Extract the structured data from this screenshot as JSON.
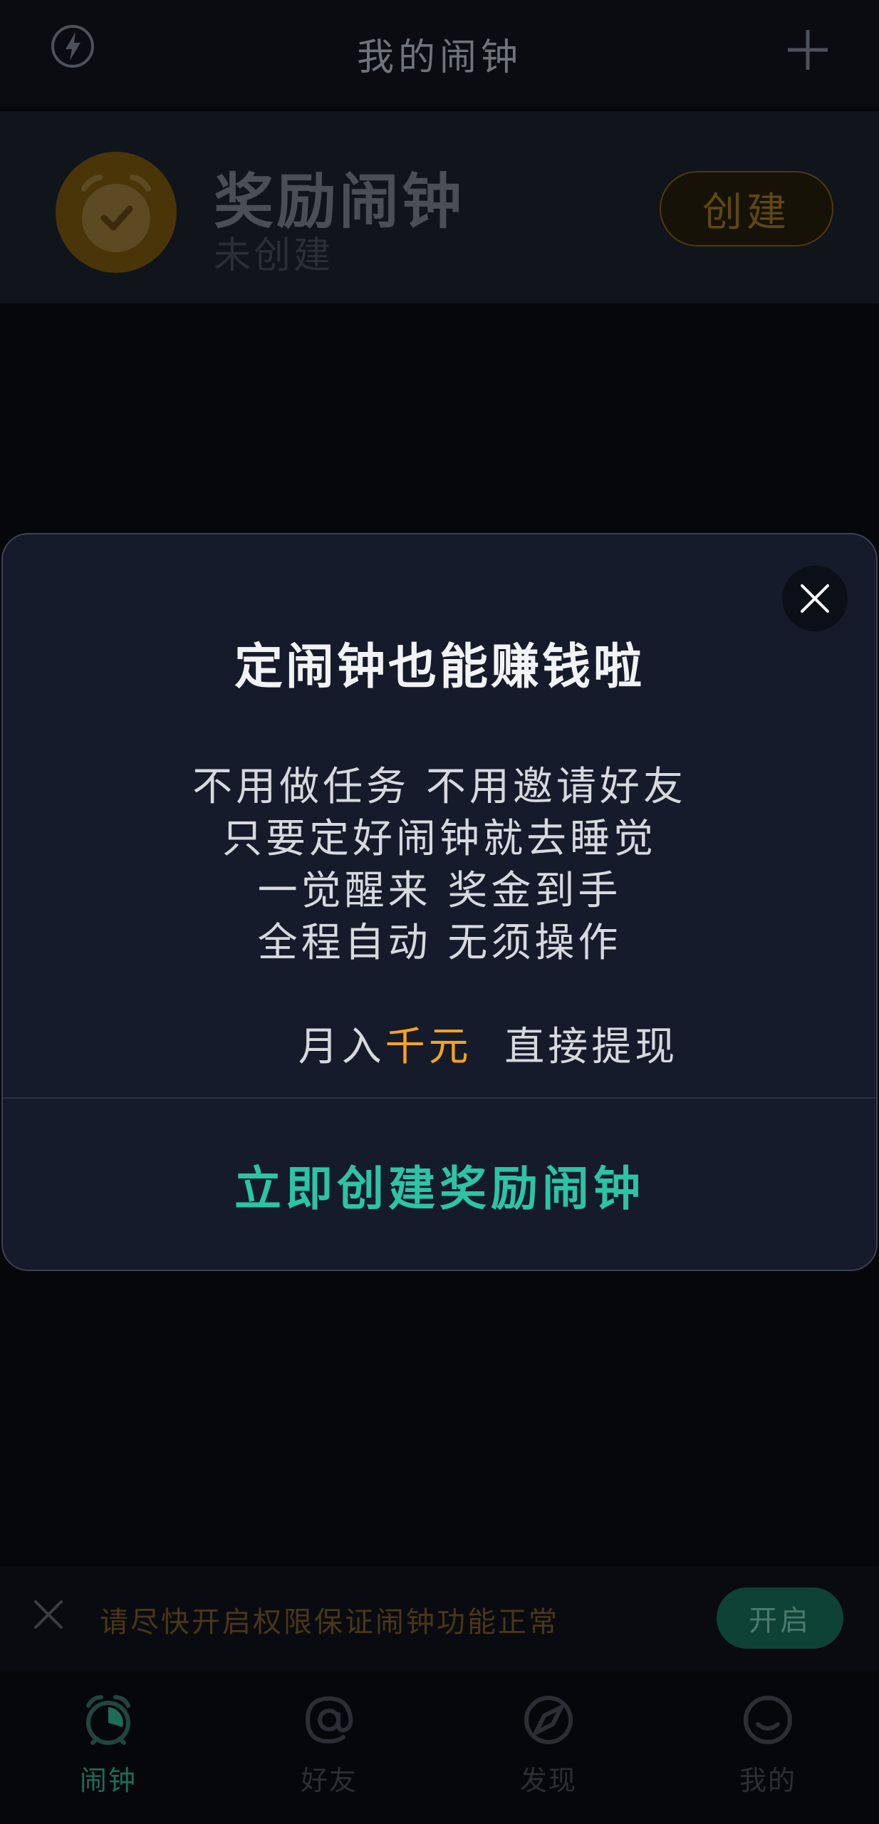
{
  "header": {
    "title": "我的闹钟",
    "left_icon": "flash-icon",
    "right_icon": "plus-icon"
  },
  "reward_card": {
    "title": "奖励闹钟",
    "status": "未创建",
    "button_label": "创建",
    "icon": "alarm-clock-check-icon"
  },
  "dialog": {
    "heading": "定闹钟也能赚钱啦",
    "lines": [
      "不用做任务  不用邀请好友",
      "只要定好闹钟就去睡觉",
      "一觉醒来  奖金到手",
      "全程自动  无须操作"
    ],
    "last_line_prefix": "月入",
    "last_line_highlight": "千元",
    "last_line_suffix": "  直接提现",
    "cta_label": "立即创建奖励闹钟",
    "close_icon": "close-icon"
  },
  "permission_bar": {
    "message": "请尽快开启权限保证闹钟功能正常",
    "button_label": "开启"
  },
  "tabs": [
    {
      "label": "闹钟",
      "icon": "alarm-clock-icon",
      "active": true
    },
    {
      "label": "好友",
      "icon": "at-sign-icon",
      "active": false
    },
    {
      "label": "发现",
      "icon": "compass-icon",
      "active": false
    },
    {
      "label": "我的",
      "icon": "smiley-face-icon",
      "active": false
    }
  ],
  "colors": {
    "accent_green": "#2cc4a4",
    "highlight_orange": "#f6a31d",
    "reward_orange": "#c98a0d"
  }
}
